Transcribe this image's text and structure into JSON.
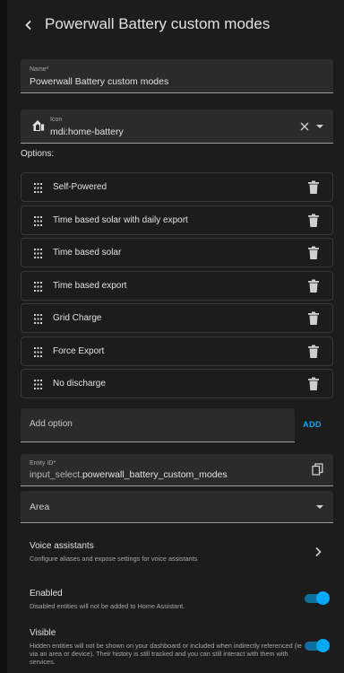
{
  "header": {
    "title": "Powerwall Battery custom modes"
  },
  "name_field": {
    "label": "Name*",
    "value": "Powerwall Battery custom modes"
  },
  "icon_field": {
    "label": "Icon",
    "value": "mdi:home-battery",
    "icon": "home-battery-icon"
  },
  "options": {
    "label": "Options:",
    "items": [
      {
        "label": "Self-Powered"
      },
      {
        "label": "Time based solar with daily export"
      },
      {
        "label": "Time based solar"
      },
      {
        "label": "Time based export"
      },
      {
        "label": "Grid Charge"
      },
      {
        "label": "Force Export"
      },
      {
        "label": "No discharge"
      }
    ],
    "add_placeholder": "Add option",
    "add_label": "ADD"
  },
  "entity_id": {
    "label": "Entity ID*",
    "prefix": "input_select.",
    "value": "powerwall_battery_custom_modes"
  },
  "area": {
    "label": "Area"
  },
  "voice_assistants": {
    "title": "Voice assistants",
    "subtitle": "Configure aliases and expose settings for voice assistants"
  },
  "enabled": {
    "title": "Enabled",
    "subtitle": "Disabled entities will not be added to Home Assistant.",
    "on": true
  },
  "visible": {
    "title": "Visible",
    "subtitle": "Hidden entities will not be shown on your dashboard or included when indirectly referenced (ie via an area or device). Their history is still tracked and you can still interact with them with services.",
    "on": true
  },
  "colors": {
    "accent": "#03a9f4",
    "background": "#1c1c1c",
    "field": "#2b2b2b",
    "text": "#e1e1e1",
    "muted": "#a8a8a8"
  }
}
